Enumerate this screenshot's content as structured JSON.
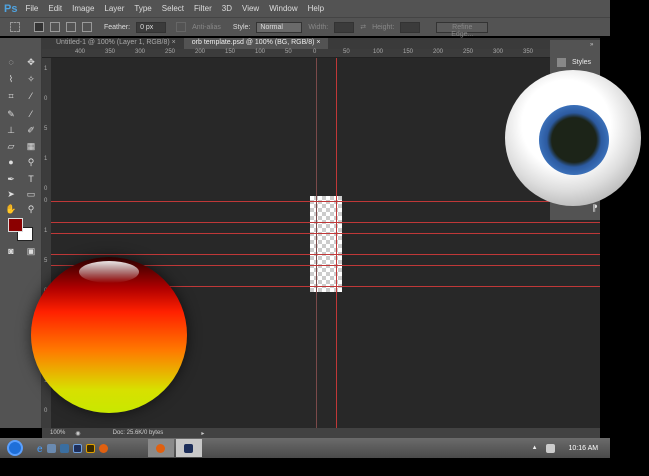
{
  "app": {
    "logo": "Ps",
    "menu": [
      "File",
      "Edit",
      "Image",
      "Layer",
      "Type",
      "Select",
      "Filter",
      "3D",
      "View",
      "Window",
      "Help"
    ]
  },
  "options": {
    "feather_label": "Feather:",
    "feather_value": "0 px",
    "antialias_label": "Anti-alias",
    "style_label": "Style:",
    "style_value": "Normal",
    "width_label": "Width:",
    "height_label": "Height:",
    "refine_label": "Refine Edge..."
  },
  "tabs": [
    {
      "label": "Untitled-1 @ 100% (Layer 1, RGB/8)",
      "close": "×"
    },
    {
      "label": "orb template.psd @ 100% (BG, RGB/8)",
      "close": "×"
    }
  ],
  "ruler": {
    "h": [
      "400",
      "350",
      "300",
      "250",
      "200",
      "150",
      "100",
      "50",
      "0",
      "50",
      "100",
      "150",
      "200",
      "250",
      "300",
      "350"
    ],
    "v": [
      "1",
      "0",
      "5",
      "1",
      "0",
      "0",
      "1",
      "5",
      "0",
      "0",
      "5",
      "1",
      "0"
    ]
  },
  "panel": {
    "styles_label": "Styles"
  },
  "status": {
    "zoom": "100%",
    "doc": "Doc: 25.6K/0 bytes"
  },
  "taskbar": {
    "time": "10:16 AM"
  },
  "colors": {
    "foreground": "#8b0000",
    "background": "#ffffff",
    "guide": "#c03838"
  }
}
